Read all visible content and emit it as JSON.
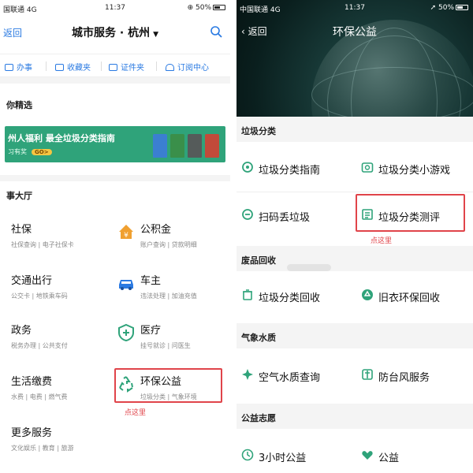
{
  "left": {
    "status": {
      "carrier": "国联通 4G",
      "time": "11:37",
      "battery": "⊕ 50%"
    },
    "nav": {
      "back": "返回",
      "title": "城市服务 · 杭州",
      "caret": "▼"
    },
    "quick": [
      "办事",
      "收藏夹",
      "证件夹",
      "订阅中心"
    ],
    "picked_title": "你精选",
    "banner": {
      "line1": "州人福利 最全垃圾分类指南",
      "line2": "习有奖",
      "go": "GO>"
    },
    "hall_title": "事大厅",
    "services": [
      {
        "title": "社保",
        "sub": "社保查询 | 电子社保卡"
      },
      {
        "title": "公积金",
        "sub": "账户查询 | 贷款明细"
      },
      {
        "title": "交通出行",
        "sub": "公交卡 | 地铁乘车码"
      },
      {
        "title": "车主",
        "sub": "违法处理 | 加油充值"
      },
      {
        "title": "政务",
        "sub": "税务办理 | 公共支付"
      },
      {
        "title": "医疗",
        "sub": "挂号就诊 | 问医生"
      },
      {
        "title": "生活缴费",
        "sub": "水费 | 电费 | 燃气费"
      },
      {
        "title": "环保公益",
        "sub": "垃圾分类 | 气象环境"
      },
      {
        "title": "更多服务",
        "sub": "文化娱乐 | 教育 | 旅游"
      }
    ],
    "hint": "点这里"
  },
  "right": {
    "status": {
      "carrier": "中国联通 4G",
      "time": "11:37",
      "battery": "➚ 50%"
    },
    "nav": {
      "back": "返回",
      "title": "环保公益"
    },
    "sections": [
      {
        "title": "垃圾分类",
        "items": [
          "垃圾分类指南",
          "垃圾分类小游戏",
          "扫码丢垃圾",
          "垃圾分类测评"
        ]
      },
      {
        "title": "废品回收",
        "items": [
          "垃圾分类回收",
          "旧衣环保回收"
        ]
      },
      {
        "title": "气象水质",
        "items": [
          "空气水质查询",
          "防台风服务"
        ]
      },
      {
        "title": "公益志愿",
        "items": [
          "3小时公益",
          "公益"
        ]
      }
    ],
    "hint": "点这里"
  },
  "colors": {
    "accent": "#2a7ae2",
    "green": "#2fa37a",
    "highlight": "#e0444a",
    "icon_orange": "#f0a030"
  }
}
